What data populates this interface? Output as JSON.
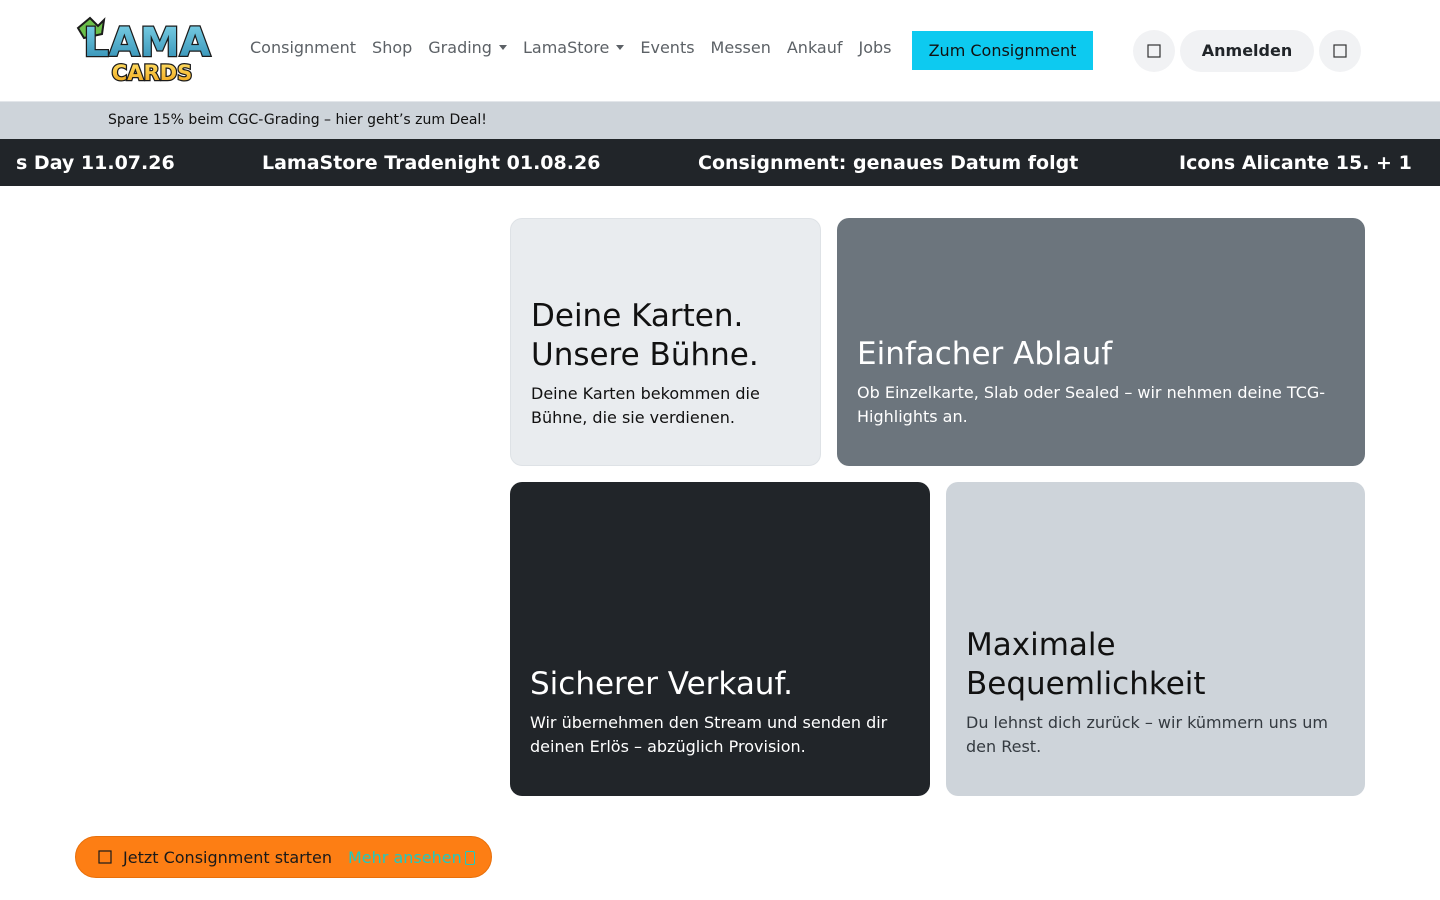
{
  "header": {
    "logo": {
      "top_text": "LAMA",
      "bottom_text": "CARDS"
    },
    "nav": [
      {
        "label": "Consignment",
        "dropdown": false
      },
      {
        "label": "Shop",
        "dropdown": false
      },
      {
        "label": "Grading",
        "dropdown": true
      },
      {
        "label": "LamaStore",
        "dropdown": true
      },
      {
        "label": "Events",
        "dropdown": false
      },
      {
        "label": "Messen",
        "dropdown": false
      },
      {
        "label": "Ankauf",
        "dropdown": false
      },
      {
        "label": "Jobs",
        "dropdown": false
      }
    ],
    "cta_label": "Zum Consignment",
    "search_icon": "search-icon",
    "login_label": "Anmelden",
    "cart_icon": "cart-icon"
  },
  "promo": {
    "text": "Spare 15% beim CGC-Grading – hier geht’s zum Deal!"
  },
  "ticker": {
    "items": [
      "s Day 11.07.26",
      "LamaStore Tradenight 01.08.26",
      "Consignment: genaues Datum folgt",
      "Icons Alicante 15. + 1"
    ]
  },
  "cards": [
    {
      "title": "Deine Karten. Unsere Bühne.",
      "text": "Deine Karten bekommen die Bühne, die sie verdienen."
    },
    {
      "title": "Einfacher Ablauf",
      "text": "Ob Einzelkarte, Slab oder Sealed – wir nehmen deine TCG-Highlights an."
    },
    {
      "title": "Sicherer Verkauf.",
      "text": "Wir übernehmen den Stream und senden dir deinen Erlös – abzüglich Provision."
    },
    {
      "title": "Maximale Bequemlichkeit",
      "text": "Du lehnst dich zurück – wir kümmern uns um den Rest."
    }
  ],
  "floating_cta": {
    "icon": "rocket-icon",
    "label": "Jetzt Consignment starten",
    "more_label": "Mehr ansehen"
  },
  "colors": {
    "accent_cyan": "#0dcaf0",
    "orange": "#fd7e14",
    "dark": "#212529",
    "grey": "#6c757d",
    "light": "#e9ecef",
    "promo_bg": "#ced4da"
  }
}
